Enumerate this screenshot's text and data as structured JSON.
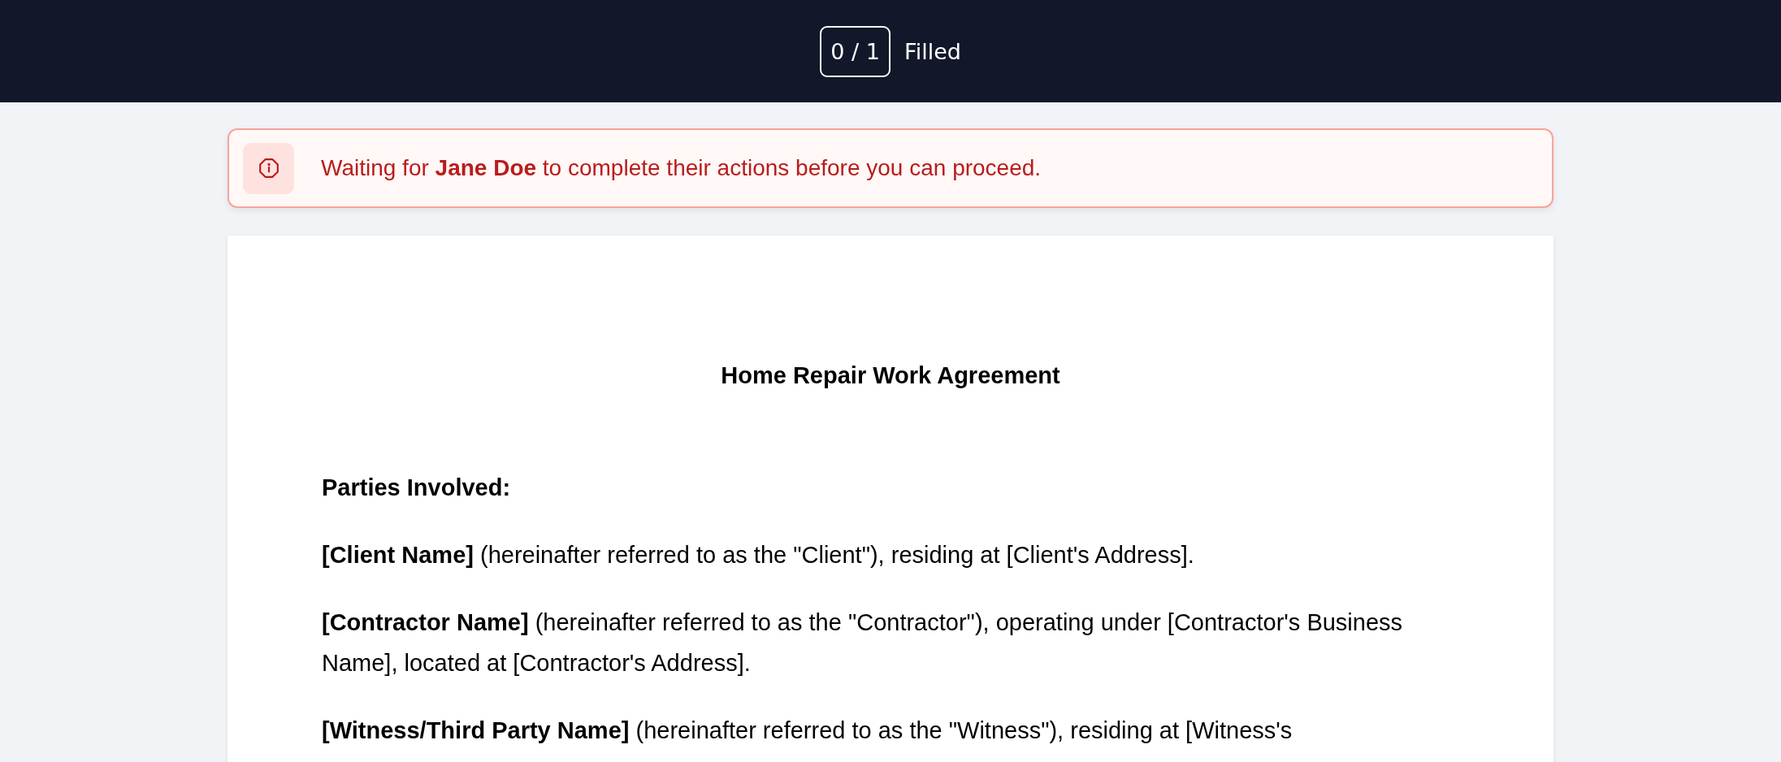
{
  "header": {
    "counter": "0 / 1",
    "counter_label": "Filled"
  },
  "alert": {
    "message": "Waiting for **Jane Doe** to complete their actions before you can proceed."
  },
  "document": {
    "title": "Home Repair Work Agreement",
    "blocks": [
      {
        "kind": "heading",
        "text": "Parties Involved:"
      },
      {
        "kind": "paragraph",
        "text": "**[Client Name]** (hereinafter referred to as the \"Client\"), residing at [Client's Address]."
      },
      {
        "kind": "paragraph",
        "text": "**[Contractor Name]** (hereinafter referred to as the \"Contractor\"), operating under [Contractor's Business Name], located at [Contractor's Address]."
      },
      {
        "kind": "paragraph",
        "text": "**[Witness/Third Party Name]** (hereinafter referred to as the \"Witness\"), residing at [Witness's"
      }
    ]
  }
}
